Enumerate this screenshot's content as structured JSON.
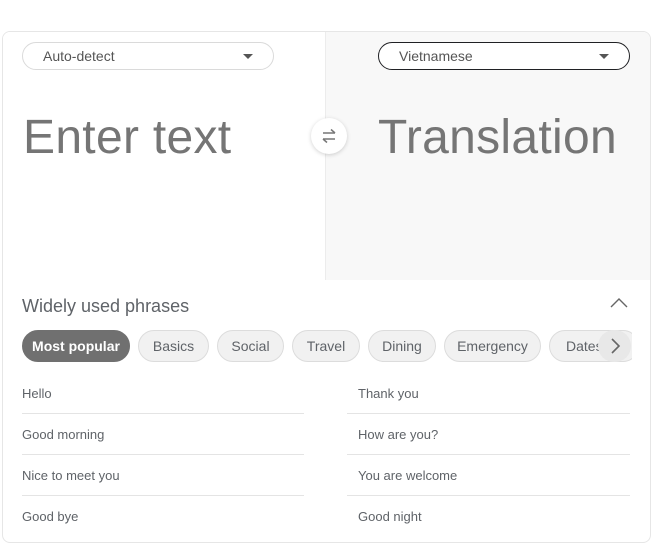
{
  "source": {
    "language": "Auto-detect",
    "placeholder": "Enter text"
  },
  "target": {
    "language": "Vietnamese",
    "placeholder": "Translation"
  },
  "swap_icon": "swap-arrows-icon",
  "phrases": {
    "title": "Widely used phrases",
    "collapse_icon": "chevron-up-icon",
    "categories": [
      {
        "label": "Most popular",
        "active": true
      },
      {
        "label": "Basics",
        "active": false
      },
      {
        "label": "Social",
        "active": false
      },
      {
        "label": "Travel",
        "active": false
      },
      {
        "label": "Dining",
        "active": false
      },
      {
        "label": "Emergency",
        "active": false
      },
      {
        "label": "Dates",
        "active": false
      }
    ],
    "next_icon": "chevron-right-icon",
    "left_items": [
      "Hello",
      "Good morning",
      "Nice to meet you",
      "Good bye"
    ],
    "right_items": [
      "Thank you",
      "How are you?",
      "You are welcome",
      "Good night"
    ]
  }
}
